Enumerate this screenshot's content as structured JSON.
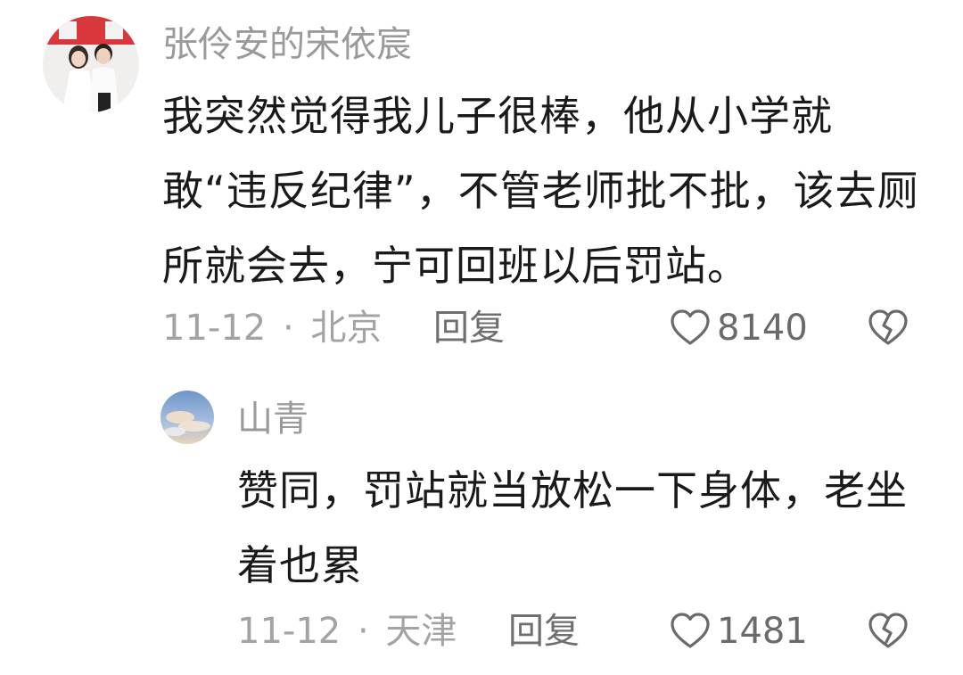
{
  "comments": [
    {
      "username": "张伶安的宋依宸",
      "text": "我突然觉得我儿子很棒，他从小学就敢“违反纪律”，不管老师批不批，该去厕所就会去，宁可回班以后罚站。",
      "date": "11-12",
      "separator": "·",
      "location": "北京",
      "reply_label": "回复",
      "like_count": "8140",
      "avatar_icon": "avatar-couple-photo",
      "like_icon": "heart-outline-icon",
      "dislike_icon": "broken-heart-icon"
    },
    {
      "username": "山青",
      "text": "赞同，罚站就当放松一下身体，老坐着也累",
      "date": "11-12",
      "separator": "·",
      "location": "天津",
      "reply_label": "回复",
      "like_count": "1481",
      "avatar_icon": "avatar-sky-clouds",
      "like_icon": "heart-outline-icon",
      "dislike_icon": "broken-heart-icon"
    }
  ],
  "colors": {
    "username": "#9a9a9a",
    "text": "#1a1a1a",
    "meta": "#a3a3a3",
    "icon": "#666666"
  }
}
